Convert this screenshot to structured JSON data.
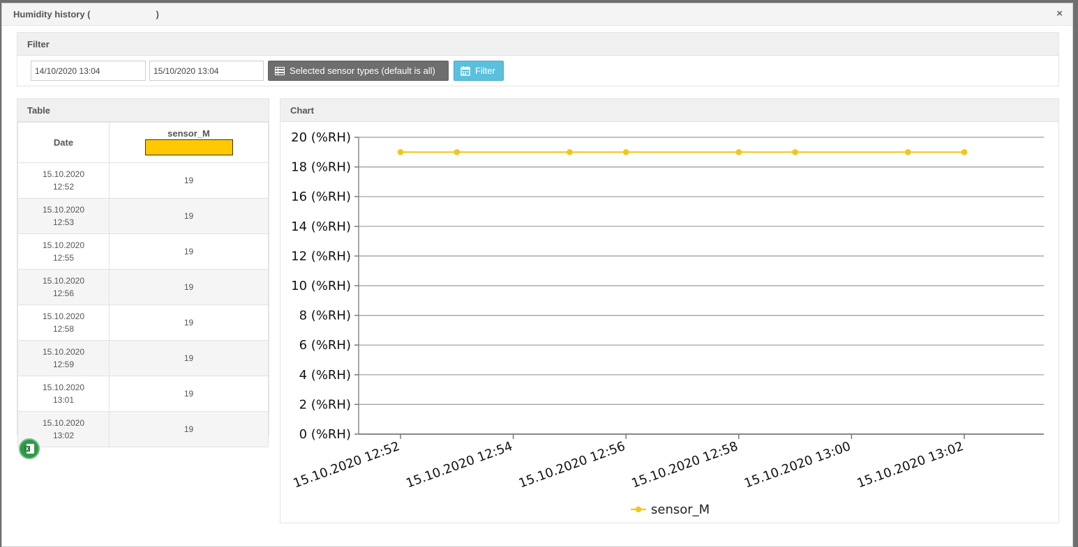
{
  "modal": {
    "title": "Humidity history (",
    "title_suffix": ")",
    "close_symbol": "×"
  },
  "filter": {
    "heading": "Filter",
    "date_from": "14/10/2020 13:04",
    "date_to": "15/10/2020 13:04",
    "sensors_button_label": "Selected sensor types (default is all)",
    "filter_button_label": "Filter"
  },
  "table": {
    "heading": "Table",
    "columns": [
      "Date",
      "sensor_M"
    ],
    "sensor_color": "#ffc800",
    "rows": [
      {
        "date": "15.10.2020",
        "time": "12:52",
        "value": "19"
      },
      {
        "date": "15.10.2020",
        "time": "12:53",
        "value": "19"
      },
      {
        "date": "15.10.2020",
        "time": "12:55",
        "value": "19"
      },
      {
        "date": "15.10.2020",
        "time": "12:56",
        "value": "19"
      },
      {
        "date": "15.10.2020",
        "time": "12:58",
        "value": "19"
      },
      {
        "date": "15.10.2020",
        "time": "12:59",
        "value": "19"
      },
      {
        "date": "15.10.2020",
        "time": "13:01",
        "value": "19"
      },
      {
        "date": "15.10.2020",
        "time": "13:02",
        "value": "19"
      }
    ]
  },
  "chart": {
    "heading": "Chart"
  },
  "chart_data": {
    "type": "line",
    "x": [
      "15.10.2020 12:52",
      "15.10.2020 12:53",
      "15.10.2020 12:55",
      "15.10.2020 12:56",
      "15.10.2020 12:58",
      "15.10.2020 12:59",
      "15.10.2020 13:01",
      "15.10.2020 13:02"
    ],
    "x_tick_labels": [
      "15.10.2020 12:52",
      "15.10.2020 12:54",
      "15.10.2020 12:56",
      "15.10.2020 12:58",
      "15.10.2020 13:00",
      "15.10.2020 13:02"
    ],
    "y_tick_labels": [
      "0 (%RH)",
      "2 (%RH)",
      "4 (%RH)",
      "6 (%RH)",
      "8 (%RH)",
      "10 (%RH)",
      "12 (%RH)",
      "14 (%RH)",
      "16 (%RH)",
      "18 (%RH)",
      "20 (%RH)"
    ],
    "ylim": [
      0,
      20
    ],
    "grid": true,
    "legend_position": "bottom-center",
    "series": [
      {
        "name": "sensor_M",
        "color": "#f5c518",
        "values": [
          19,
          19,
          19,
          19,
          19,
          19,
          19,
          19
        ]
      }
    ]
  }
}
